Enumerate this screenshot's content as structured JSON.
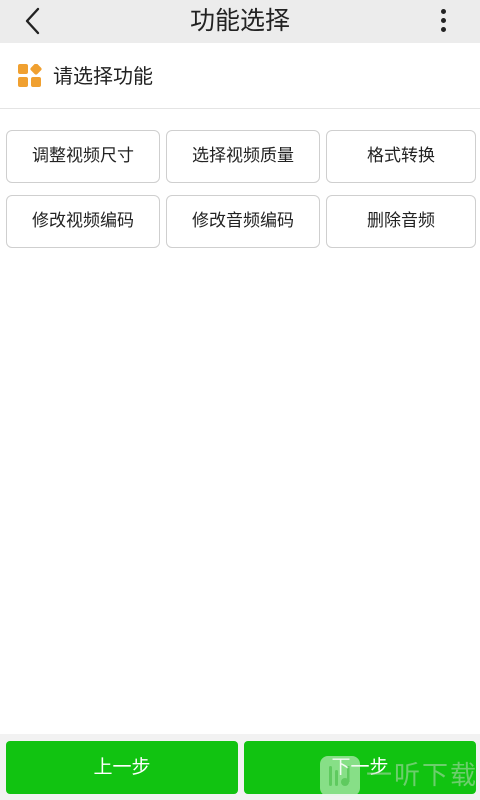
{
  "header": {
    "title": "功能选择",
    "back_icon": "chevron-left-icon",
    "more_icon": "more-vertical-icon"
  },
  "section": {
    "icon": "grid-apps-icon",
    "title": "请选择功能"
  },
  "functions": [
    {
      "label": "调整视频尺寸"
    },
    {
      "label": "选择视频质量"
    },
    {
      "label": "格式转换"
    },
    {
      "label": "修改视频编码"
    },
    {
      "label": "修改音频编码"
    },
    {
      "label": "删除音频"
    }
  ],
  "footer": {
    "prev_label": "上一步",
    "next_label": "下一步"
  },
  "watermark": {
    "text": "一听下载"
  },
  "colors": {
    "accent_green": "#11c311",
    "icon_orange": "#f0a030",
    "topbar_bg": "#ececec"
  }
}
